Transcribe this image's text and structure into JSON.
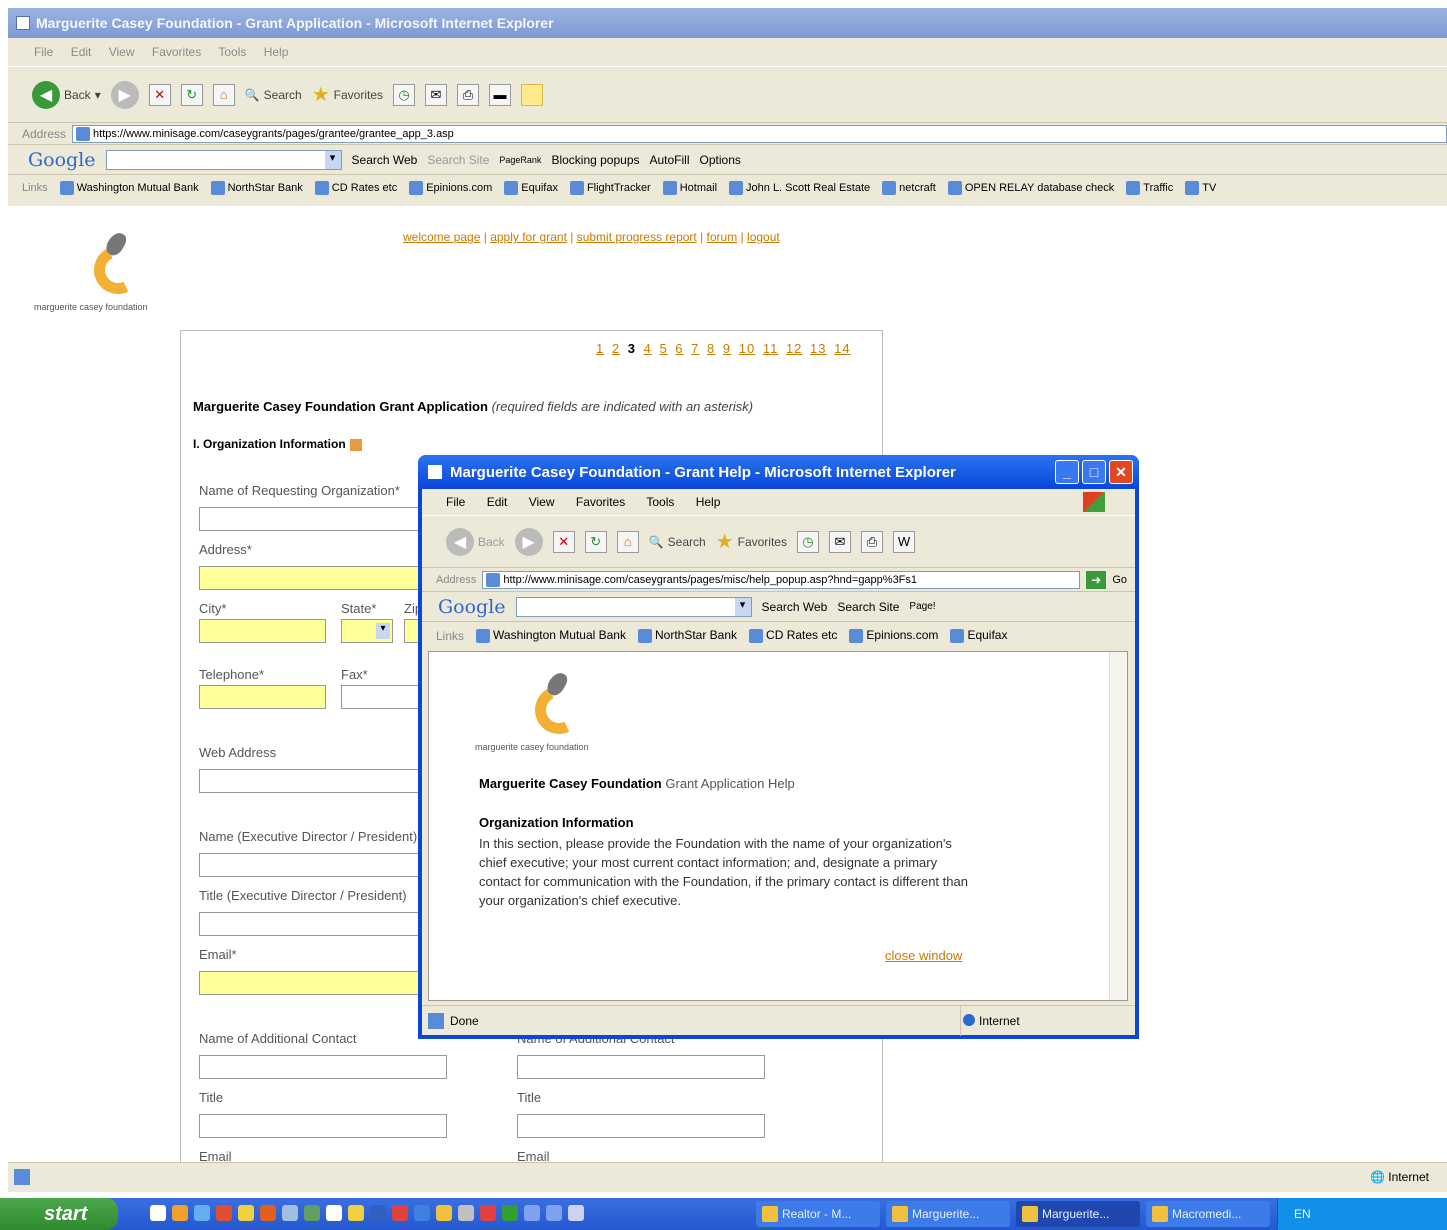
{
  "main_window": {
    "title": "Marguerite Casey Foundation - Grant Application - Microsoft Internet Explorer",
    "menu": [
      "File",
      "Edit",
      "View",
      "Favorites",
      "Tools",
      "Help"
    ],
    "toolbar": {
      "back": "Back",
      "search": "Search",
      "favorites": "Favorites"
    },
    "address_label": "Address",
    "address_url": "https://www.minisage.com/caseygrants/pages/grantee/grantee_app_3.asp",
    "google": {
      "logo": "Google",
      "search_web": "Search Web",
      "search_site": "Search Site",
      "pagerank": "PageRank",
      "popups": "Blocking popups",
      "autofill": "AutoFill",
      "options": "Options"
    },
    "links_label": "Links",
    "links": [
      "Washington Mutual Bank",
      "NorthStar Bank",
      "CD Rates etc",
      "Epinions.com",
      "Equifax",
      "FlightTracker",
      "Hotmail",
      "John L. Scott Real Estate",
      "netcraft",
      "OPEN RELAY database check",
      "Traffic",
      "TV"
    ],
    "status_zone": "Internet"
  },
  "site": {
    "logo_text": "marguerite casey foundation",
    "logo_bold": "casey",
    "nav": [
      "welcome page",
      "apply for grant",
      "submit progress report",
      "forum",
      "logout"
    ],
    "steps": [
      "1",
      "2",
      "3",
      "4",
      "5",
      "6",
      "7",
      "8",
      "9",
      "10",
      "11",
      "12",
      "13",
      "14"
    ],
    "current_step": "3",
    "form_title": "Marguerite Casey Foundation Grant Application",
    "form_note": "(required fields are indicated with an asterisk)",
    "section": "I. Organization Information",
    "fields": {
      "org_name": "Name of Requesting Organization*",
      "address": "Address*",
      "city": "City*",
      "state": "State*",
      "zip": "Zip",
      "telephone": "Telephone*",
      "fax": "Fax*",
      "web": "Web Address",
      "exec_name": "Name (Executive Director / President)",
      "exec_title": "Title (Executive Director / President)",
      "email": "Email*",
      "additional_contact": "Name of Additional Contact",
      "additional_contact_2": "Name of Additional Contact",
      "title_1": "Title",
      "title_2": "Title",
      "email_1": "Email",
      "email_2": "Email"
    }
  },
  "popup": {
    "title": "Marguerite Casey Foundation - Grant Help - Microsoft Internet Explorer",
    "menu": [
      "File",
      "Edit",
      "View",
      "Favorites",
      "Tools",
      "Help"
    ],
    "toolbar": {
      "back": "Back",
      "search": "Search",
      "favorites": "Favorites"
    },
    "address_label": "Address",
    "address_url": "http://www.minisage.com/caseygrants/pages/misc/help_popup.asp?hnd=gapp%3Fs1",
    "go": "Go",
    "google": {
      "logo": "Google",
      "search_web": "Search Web",
      "search_site": "Search Site",
      "pagerank": "Page!"
    },
    "links_label": "Links",
    "links": [
      "Washington Mutual Bank",
      "NorthStar Bank",
      "CD Rates etc",
      "Epinions.com",
      "Equifax"
    ],
    "help_title_bold": "Marguerite Casey Foundation",
    "help_title_rest": "Grant Application Help",
    "help_section": "Organization Information",
    "help_text": "In this section, please provide the Foundation with the name of your organization's chief executive; your most current contact information; and, designate a primary contact for communication with the Foundation, if the primary contact is different than your organization's chief executive.",
    "close_link": "close window",
    "status": "Done",
    "zone": "Internet"
  },
  "taskbar": {
    "start": "start",
    "items": [
      "Realtor - M...",
      "Marguerite...",
      "Marguerite...",
      "Macromedi..."
    ],
    "lang": "EN"
  },
  "colors": {
    "accent_link": "#cc7a00",
    "required_field": "#ffff99",
    "xp_blue": "#0a46d8"
  }
}
